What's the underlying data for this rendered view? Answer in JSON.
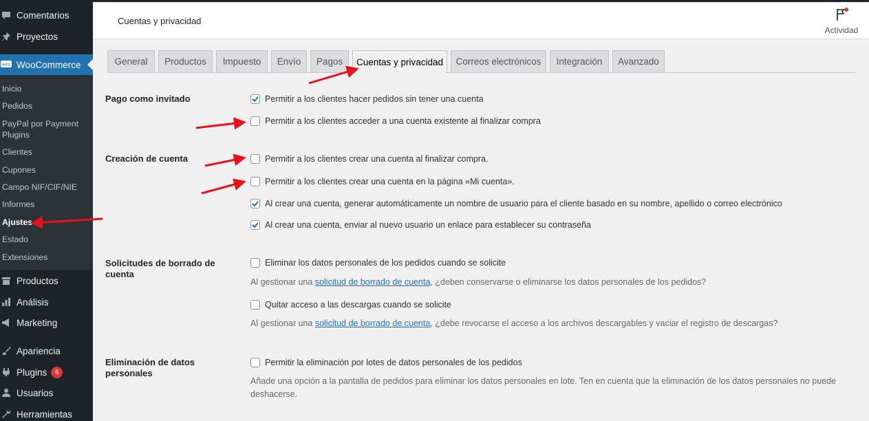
{
  "sidebar": {
    "top_items": [
      {
        "label": "Comentarios",
        "icon": "comment-icon"
      },
      {
        "label": "Proyectos",
        "icon": "pin-icon"
      },
      {
        "label": "WooCommerce",
        "icon": "woocommerce-icon"
      }
    ],
    "submenu": [
      "Inicio",
      "Pedidos",
      "PayPal por Payment Plugins",
      "Clientes",
      "Cupones",
      "Campo NIF/CIF/NIE",
      "Informes",
      "Ajustes",
      "Estado",
      "Extensiones"
    ],
    "bottom_items": [
      {
        "label": "Productos",
        "icon": "archive-icon"
      },
      {
        "label": "Análisis",
        "icon": "chart-bar-icon"
      },
      {
        "label": "Marketing",
        "icon": "megaphone-icon"
      },
      {
        "label": "Apariencia",
        "icon": "paintbrush-icon"
      },
      {
        "label": "Plugins",
        "icon": "plugin-icon",
        "badge": "6"
      },
      {
        "label": "Usuarios",
        "icon": "user-icon"
      },
      {
        "label": "Herramientas",
        "icon": "wrench-icon"
      }
    ]
  },
  "header": {
    "title": "Cuentas y privacidad",
    "activity": "Actividad"
  },
  "tabs": [
    "General",
    "Productos",
    "Impuesto",
    "Envío",
    "Pagos",
    "Cuentas y privacidad",
    "Correos electrónicos",
    "Integración",
    "Avanzado"
  ],
  "sections": {
    "guest": {
      "label": "Pago como invitado",
      "options": [
        {
          "text": "Permitir a los clientes hacer pedidos sin tener una cuenta",
          "checked": true
        },
        {
          "text": "Permitir a los clientes acceder a una cuenta existente al finalizar compra",
          "checked": false
        }
      ]
    },
    "account": {
      "label": "Creación de cuenta",
      "options": [
        {
          "text": "Permitir a los clientes crear una cuenta al finalizar compra.",
          "checked": false
        },
        {
          "text": "Permitir a los clientes crear una cuenta en la página «Mi cuenta».",
          "checked": false
        },
        {
          "text": "Al crear una cuenta, generar automáticamente un nombre de usuario para el cliente basado en su nombre, apellido o correo electrónico",
          "checked": true
        },
        {
          "text": "Al crear una cuenta, enviar al nuevo usuario un enlace para establecer su contraseña",
          "checked": true
        }
      ]
    },
    "erasure": {
      "label": "Solicitudes de borrado de cuenta",
      "opt1": "Eliminar los datos personales de los pedidos cuando se solicite",
      "desc1_pre": "Al gestionar una ",
      "link": "solicitud de borrado de cuenta",
      "desc1_post": ", ¿deben conservarse o eliminarse los datos personales de los pedidos?",
      "opt2": "Quitar acceso a las descargas cuando se solicite",
      "desc2_pre": "Al gestionar una ",
      "desc2_post": ", ¿debe revocarse el acceso a los archivos descargables y vaciar el registro de descargas?"
    },
    "personal": {
      "label": "Eliminación de datos personales",
      "opt": "Permitir la eliminación por lotes de datos personales de los pedidos",
      "desc": "Añade una opción a la pantalla de pedidos para eliminar los datos personales en lote. Ten en cuenta que la eliminación de los datos personales no puede deshacerse."
    }
  },
  "colors": {
    "sidebar": "#1d2327",
    "accent": "#2271b1",
    "arrow": "#e8101a"
  }
}
